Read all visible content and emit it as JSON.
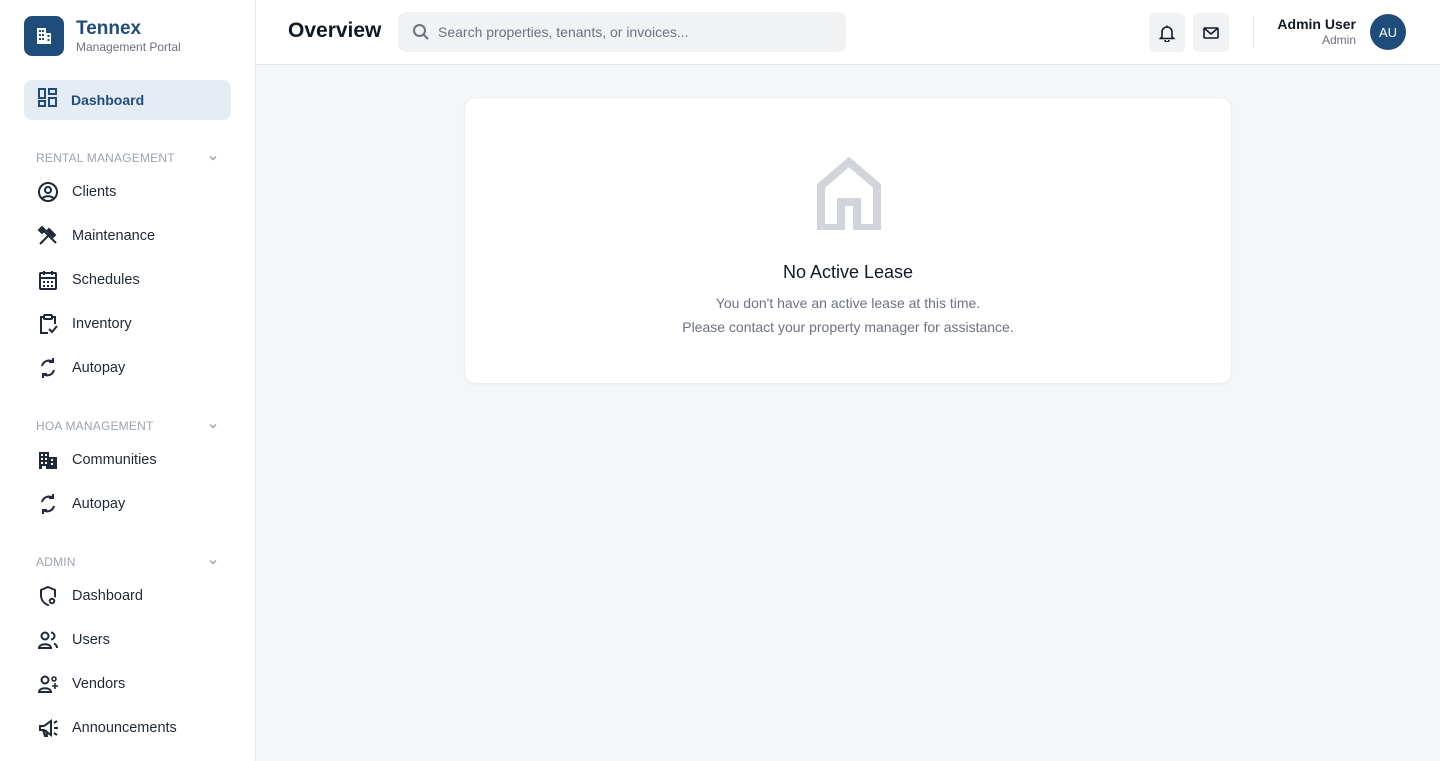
{
  "brand": {
    "name": "Tennex",
    "subtitle": "Management Portal"
  },
  "nav": {
    "active": {
      "label": "Dashboard",
      "icon": "dashboard-grid-icon"
    },
    "sections": [
      {
        "title": "RENTAL MANAGEMENT",
        "items": [
          {
            "label": "Clients",
            "icon": "user-circle-icon"
          },
          {
            "label": "Maintenance",
            "icon": "tools-icon"
          },
          {
            "label": "Schedules",
            "icon": "calendar-icon"
          },
          {
            "label": "Inventory",
            "icon": "clipboard-check-icon"
          },
          {
            "label": "Autopay",
            "icon": "refresh-icon"
          }
        ]
      },
      {
        "title": "HOA MANAGEMENT",
        "items": [
          {
            "label": "Communities",
            "icon": "building-icon"
          },
          {
            "label": "Autopay",
            "icon": "refresh-icon"
          }
        ]
      },
      {
        "title": "ADMIN",
        "items": [
          {
            "label": "Dashboard",
            "icon": "shield-gear-icon"
          },
          {
            "label": "Users",
            "icon": "users-icon"
          },
          {
            "label": "Vendors",
            "icon": "vendor-icon"
          },
          {
            "label": "Announcements",
            "icon": "megaphone-icon"
          }
        ]
      }
    ]
  },
  "header": {
    "title": "Overview",
    "search_placeholder": "Search properties, tenants, or invoices...",
    "user_name": "Admin User",
    "user_role": "Admin",
    "avatar_initials": "AU"
  },
  "empty_state": {
    "icon": "house-icon",
    "title": "No Active Lease",
    "line1": "You don't have an active lease at this time.",
    "line2": "Please contact your property manager for assistance."
  },
  "colors": {
    "brand": "#1e4d7b",
    "active_bg": "#e6ecf3",
    "muted": "#9ca3af"
  }
}
